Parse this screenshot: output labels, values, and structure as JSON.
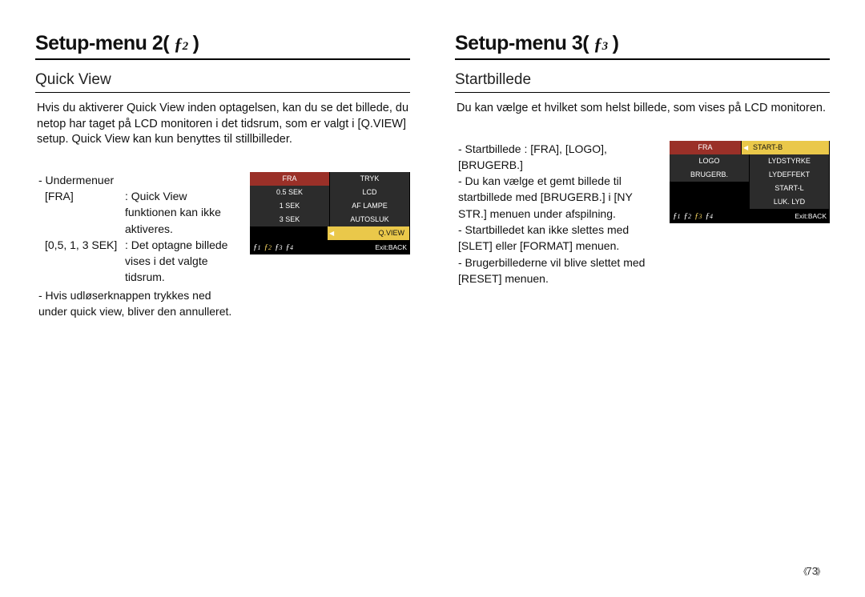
{
  "page_number": "73",
  "left": {
    "heading": "Setup-menu 2(",
    "heading_close": ")",
    "icon_sub": "2",
    "subheading": "Quick View",
    "intro": "Hvis du aktiverer Quick View inden optagelsen, kan du se det billede, du netop har taget på LCD monitoren i det tidsrum, som er valgt i [Q.VIEW] setup. Quick View kan kun benyttes til stillbilleder.",
    "submenu_label": "- Undermenuer",
    "def1_label": "[FRA]",
    "def1_val": ": Quick View funktionen kan ikke aktiveres.",
    "def2_label": "[0,5, 1, 3 SEK]",
    "def2_val": ": Det optagne billede vises i det valgte tidsrum.",
    "note": "- Hvis udløserknappen trykkes ned under quick view, bliver den annulleret.",
    "lcd": {
      "rows": [
        {
          "l": "FRA",
          "r": "TRYK",
          "sel": "l"
        },
        {
          "l": "0.5 SEK",
          "r": "LCD"
        },
        {
          "l": "1 SEK",
          "r": "AF LAMPE"
        },
        {
          "l": "3 SEK",
          "r": "AUTOSLUK"
        },
        {
          "l": "",
          "r": "Q.VIEW",
          "sel": "r",
          "arrow": true
        }
      ],
      "exit": "Exit:BACK",
      "active_tab": 2
    }
  },
  "right": {
    "heading": "Setup-menu 3(",
    "heading_close": ")",
    "icon_sub": "3",
    "subheading": "Startbillede",
    "intro": "Du kan vælge et hvilket som helst billede, som vises på LCD monitoren.",
    "b1": "- Startbillede : [FRA], [LOGO], [BRUGERB.]",
    "b2": "- Du kan vælge et gemt billede til startbillede med [BRUGERB.] i [NY STR.] menuen under afspilning.",
    "b3": "- Startbilledet kan ikke slettes med [SLET] eller [FORMAT] menuen.",
    "b4": "- Brugerbillederne vil blive slettet med [RESET] menuen.",
    "lcd": {
      "rows": [
        {
          "l": "FRA",
          "r": "START-B",
          "sel": "both",
          "arrow": true
        },
        {
          "l": "LOGO",
          "r": "LYDSTYRKE"
        },
        {
          "l": "BRUGERB.",
          "r": "LYDEFFEKT"
        },
        {
          "l": "",
          "r": "START-L",
          "blackL": true
        },
        {
          "l": "",
          "r": "LUK. LYD",
          "blackL": true
        }
      ],
      "exit": "Exit:BACK",
      "active_tab": 3
    }
  }
}
